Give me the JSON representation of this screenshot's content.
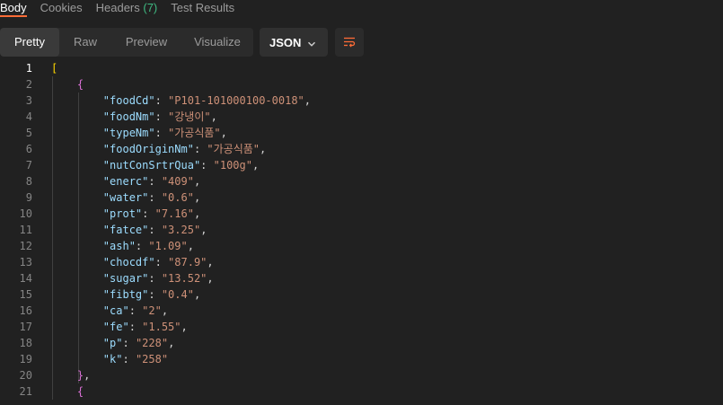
{
  "tabs": [
    {
      "label": "Body",
      "count": "",
      "active": true
    },
    {
      "label": "Cookies",
      "count": "",
      "active": false
    },
    {
      "label": "Headers",
      "count": "(7)",
      "active": false
    },
    {
      "label": "Test Results",
      "count": "",
      "active": false
    }
  ],
  "toolbar": {
    "views": [
      "Pretty",
      "Raw",
      "Preview",
      "Visualize"
    ],
    "active_view": "Pretty",
    "format": "JSON"
  },
  "editor": {
    "current_line": 1,
    "lines": [
      {
        "n": "1",
        "tokens": [
          {
            "t": "[",
            "c": "bracket-y"
          }
        ]
      },
      {
        "n": "2",
        "tokens": [
          {
            "t": "    "
          },
          {
            "t": "{",
            "c": "bracket-p"
          }
        ]
      },
      {
        "n": "3",
        "tokens": [
          {
            "t": "        "
          },
          {
            "t": "\"foodCd\"",
            "c": "key"
          },
          {
            "t": ": ",
            "c": "punc"
          },
          {
            "t": "\"P101-101000100-0018\"",
            "c": "str"
          },
          {
            "t": ",",
            "c": "punc"
          }
        ]
      },
      {
        "n": "4",
        "tokens": [
          {
            "t": "        "
          },
          {
            "t": "\"foodNm\"",
            "c": "key"
          },
          {
            "t": ": ",
            "c": "punc"
          },
          {
            "t": "\"강냉이\"",
            "c": "str"
          },
          {
            "t": ",",
            "c": "punc"
          }
        ]
      },
      {
        "n": "5",
        "tokens": [
          {
            "t": "        "
          },
          {
            "t": "\"typeNm\"",
            "c": "key"
          },
          {
            "t": ": ",
            "c": "punc"
          },
          {
            "t": "\"가공식품\"",
            "c": "str"
          },
          {
            "t": ",",
            "c": "punc"
          }
        ]
      },
      {
        "n": "6",
        "tokens": [
          {
            "t": "        "
          },
          {
            "t": "\"foodOriginNm\"",
            "c": "key"
          },
          {
            "t": ": ",
            "c": "punc"
          },
          {
            "t": "\"가공식품\"",
            "c": "str"
          },
          {
            "t": ",",
            "c": "punc"
          }
        ]
      },
      {
        "n": "7",
        "tokens": [
          {
            "t": "        "
          },
          {
            "t": "\"nutConSrtrQua\"",
            "c": "key"
          },
          {
            "t": ": ",
            "c": "punc"
          },
          {
            "t": "\"100g\"",
            "c": "str"
          },
          {
            "t": ",",
            "c": "punc"
          }
        ]
      },
      {
        "n": "8",
        "tokens": [
          {
            "t": "        "
          },
          {
            "t": "\"enerc\"",
            "c": "key"
          },
          {
            "t": ": ",
            "c": "punc"
          },
          {
            "t": "\"409\"",
            "c": "str"
          },
          {
            "t": ",",
            "c": "punc"
          }
        ]
      },
      {
        "n": "9",
        "tokens": [
          {
            "t": "        "
          },
          {
            "t": "\"water\"",
            "c": "key"
          },
          {
            "t": ": ",
            "c": "punc"
          },
          {
            "t": "\"0.6\"",
            "c": "str"
          },
          {
            "t": ",",
            "c": "punc"
          }
        ]
      },
      {
        "n": "10",
        "tokens": [
          {
            "t": "        "
          },
          {
            "t": "\"prot\"",
            "c": "key"
          },
          {
            "t": ": ",
            "c": "punc"
          },
          {
            "t": "\"7.16\"",
            "c": "str"
          },
          {
            "t": ",",
            "c": "punc"
          }
        ]
      },
      {
        "n": "11",
        "tokens": [
          {
            "t": "        "
          },
          {
            "t": "\"fatce\"",
            "c": "key"
          },
          {
            "t": ": ",
            "c": "punc"
          },
          {
            "t": "\"3.25\"",
            "c": "str"
          },
          {
            "t": ",",
            "c": "punc"
          }
        ]
      },
      {
        "n": "12",
        "tokens": [
          {
            "t": "        "
          },
          {
            "t": "\"ash\"",
            "c": "key"
          },
          {
            "t": ": ",
            "c": "punc"
          },
          {
            "t": "\"1.09\"",
            "c": "str"
          },
          {
            "t": ",",
            "c": "punc"
          }
        ]
      },
      {
        "n": "13",
        "tokens": [
          {
            "t": "        "
          },
          {
            "t": "\"chocdf\"",
            "c": "key"
          },
          {
            "t": ": ",
            "c": "punc"
          },
          {
            "t": "\"87.9\"",
            "c": "str"
          },
          {
            "t": ",",
            "c": "punc"
          }
        ]
      },
      {
        "n": "14",
        "tokens": [
          {
            "t": "        "
          },
          {
            "t": "\"sugar\"",
            "c": "key"
          },
          {
            "t": ": ",
            "c": "punc"
          },
          {
            "t": "\"13.52\"",
            "c": "str"
          },
          {
            "t": ",",
            "c": "punc"
          }
        ]
      },
      {
        "n": "15",
        "tokens": [
          {
            "t": "        "
          },
          {
            "t": "\"fibtg\"",
            "c": "key"
          },
          {
            "t": ": ",
            "c": "punc"
          },
          {
            "t": "\"0.4\"",
            "c": "str"
          },
          {
            "t": ",",
            "c": "punc"
          }
        ]
      },
      {
        "n": "16",
        "tokens": [
          {
            "t": "        "
          },
          {
            "t": "\"ca\"",
            "c": "key"
          },
          {
            "t": ": ",
            "c": "punc"
          },
          {
            "t": "\"2\"",
            "c": "str"
          },
          {
            "t": ",",
            "c": "punc"
          }
        ]
      },
      {
        "n": "17",
        "tokens": [
          {
            "t": "        "
          },
          {
            "t": "\"fe\"",
            "c": "key"
          },
          {
            "t": ": ",
            "c": "punc"
          },
          {
            "t": "\"1.55\"",
            "c": "str"
          },
          {
            "t": ",",
            "c": "punc"
          }
        ]
      },
      {
        "n": "18",
        "tokens": [
          {
            "t": "        "
          },
          {
            "t": "\"p\"",
            "c": "key"
          },
          {
            "t": ": ",
            "c": "punc"
          },
          {
            "t": "\"228\"",
            "c": "str"
          },
          {
            "t": ",",
            "c": "punc"
          }
        ]
      },
      {
        "n": "19",
        "tokens": [
          {
            "t": "        "
          },
          {
            "t": "\"k\"",
            "c": "key"
          },
          {
            "t": ": ",
            "c": "punc"
          },
          {
            "t": "\"258\"",
            "c": "str"
          }
        ]
      },
      {
        "n": "20",
        "tokens": [
          {
            "t": "    "
          },
          {
            "t": "}",
            "c": "bracket-p"
          },
          {
            "t": ",",
            "c": "punc"
          }
        ]
      },
      {
        "n": "21",
        "tokens": [
          {
            "t": "    "
          },
          {
            "t": "{",
            "c": "bracket-p"
          }
        ]
      }
    ]
  },
  "colors": {
    "background": "#212121",
    "accent": "#ff6c37",
    "count_green": "#3fb982",
    "key": "#9cdcfe",
    "string": "#ce9178"
  }
}
